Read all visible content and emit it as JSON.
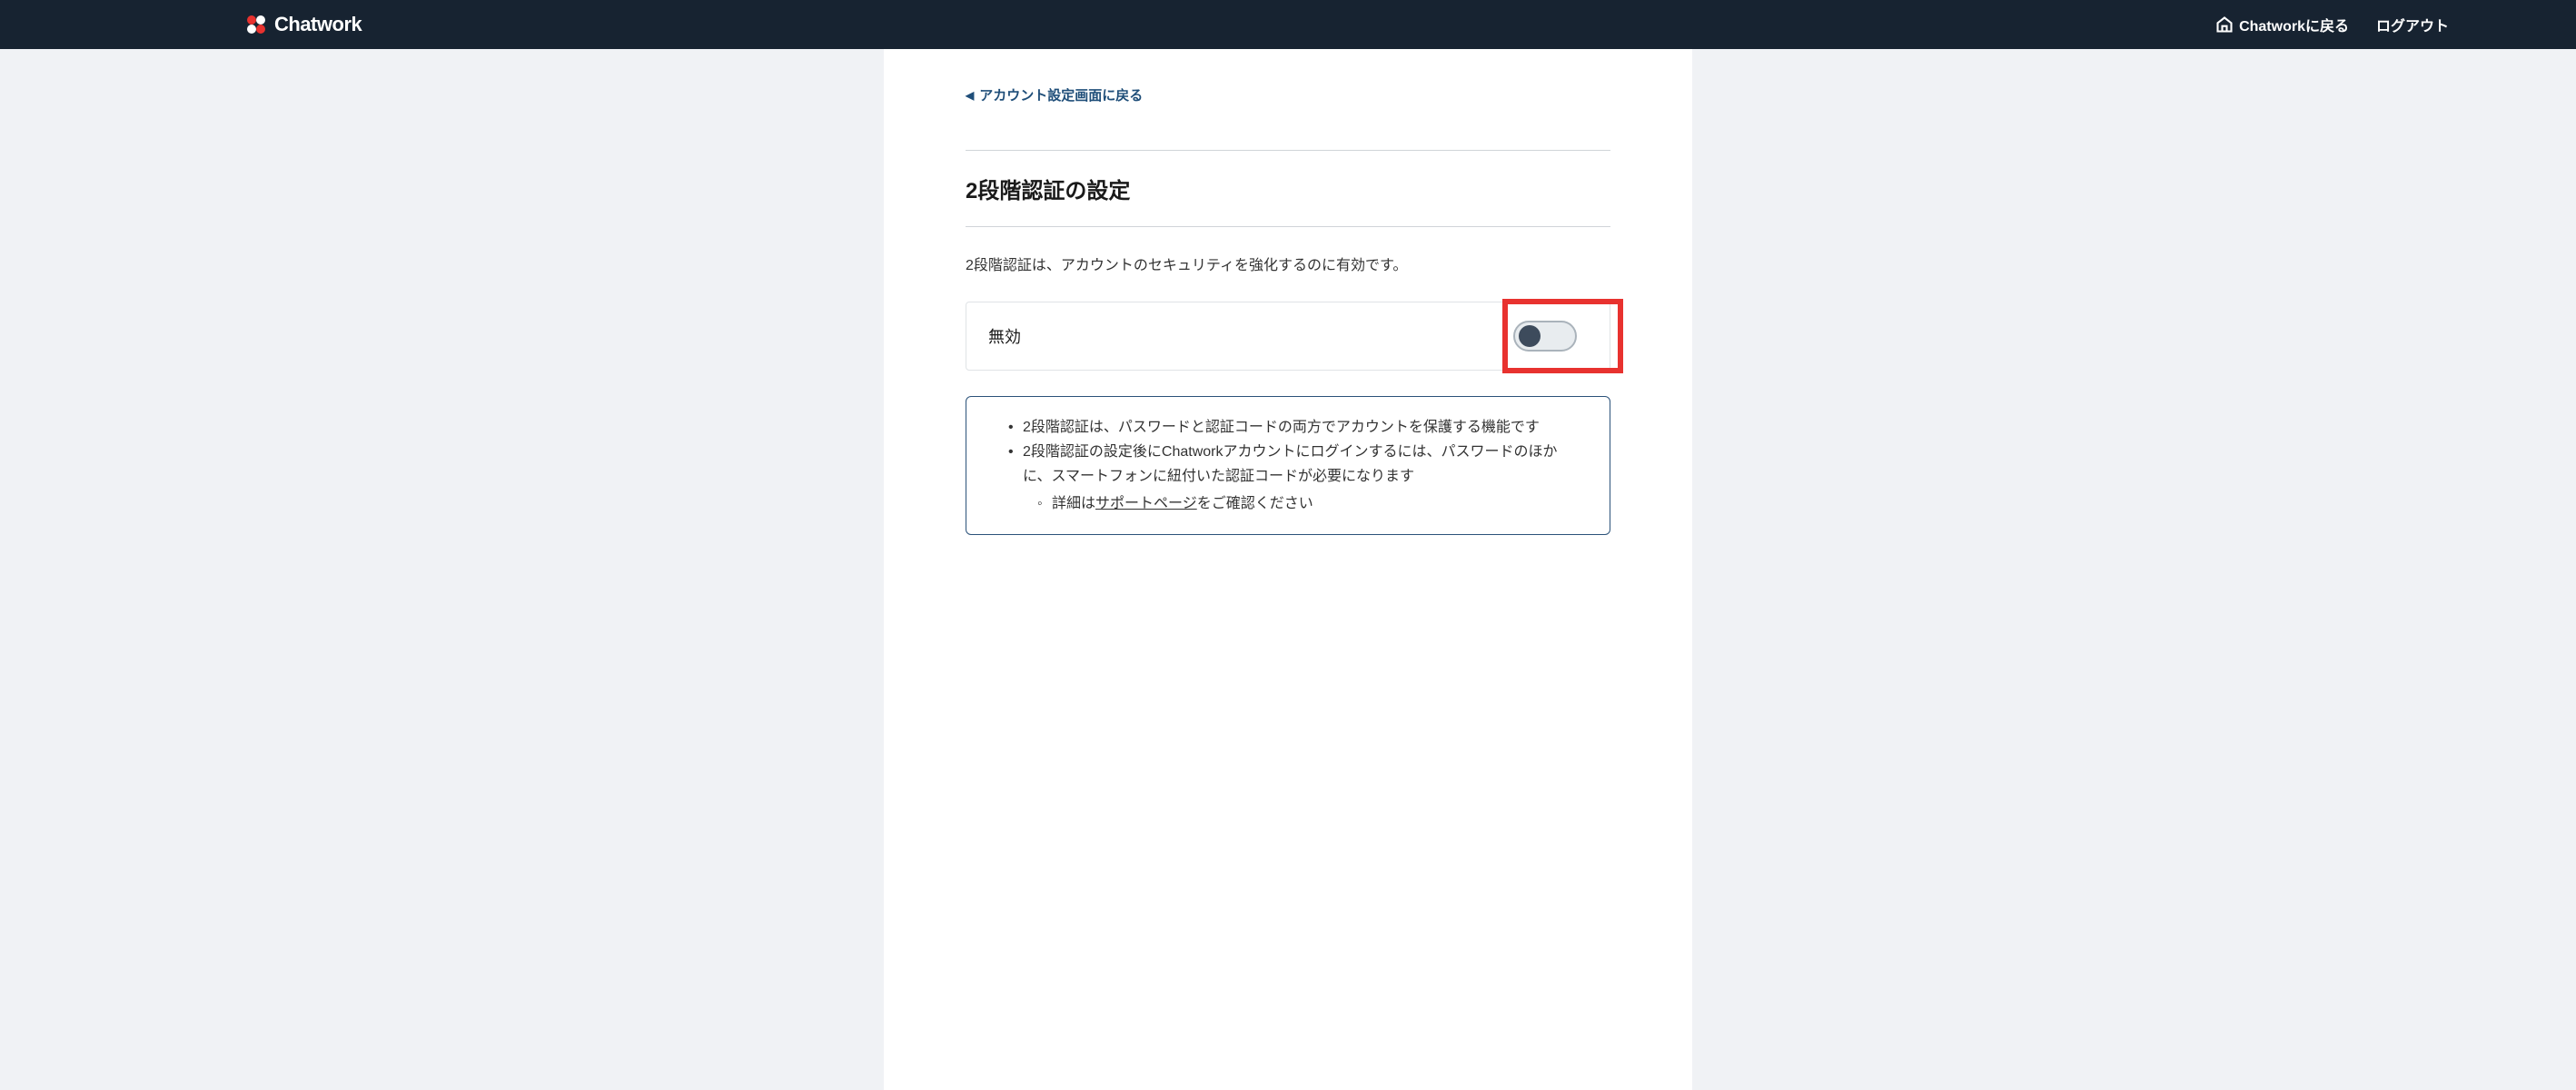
{
  "header": {
    "logo_text": "Chatwork",
    "nav_back": "Chatworkに戻る",
    "nav_logout": "ログアウト"
  },
  "main": {
    "back_link": "アカウント設定画面に戻る",
    "title": "2段階認証の設定",
    "description": "2段階認証は、アカウントのセキュリティを強化するのに有効です。",
    "toggle": {
      "label": "無効",
      "state": "off"
    },
    "info": {
      "item1": "2段階認証は、パスワードと認証コードの両方でアカウントを保護する機能です",
      "item2": "2段階認証の設定後にChatworkアカウントにログインするには、パスワードのほかに、スマートフォンに紐付いた認証コードが必要になります",
      "sub_prefix": "詳細は",
      "sub_link": "サポートページ",
      "sub_suffix": "をご確認ください"
    }
  }
}
